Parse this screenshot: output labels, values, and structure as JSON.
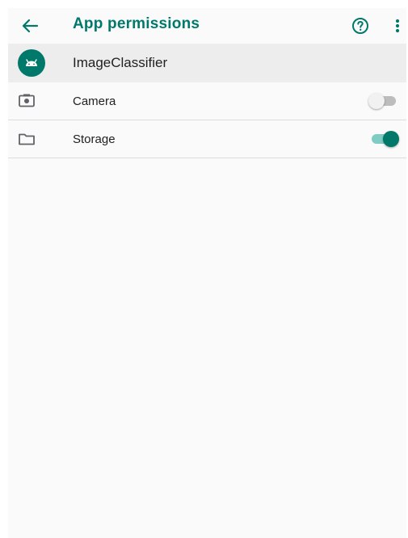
{
  "app_bar": {
    "title": "App permissions",
    "back_icon": "arrow-left-icon",
    "help_icon": "help-circle-icon",
    "overflow_icon": "more-vert-icon",
    "accent_color": "#00796b"
  },
  "app_header": {
    "app_name": "ImageClassifier",
    "avatar_icon": "android-icon"
  },
  "permissions": [
    {
      "label": "Camera",
      "icon": "camera-icon",
      "enabled": false
    },
    {
      "label": "Storage",
      "icon": "folder-icon",
      "enabled": true
    }
  ],
  "colors": {
    "accent": "#00796b",
    "track_on": "#80cbc4",
    "track_off": "#bdbdbd",
    "header_row_bg": "#ededed",
    "background": "#fafafa"
  }
}
